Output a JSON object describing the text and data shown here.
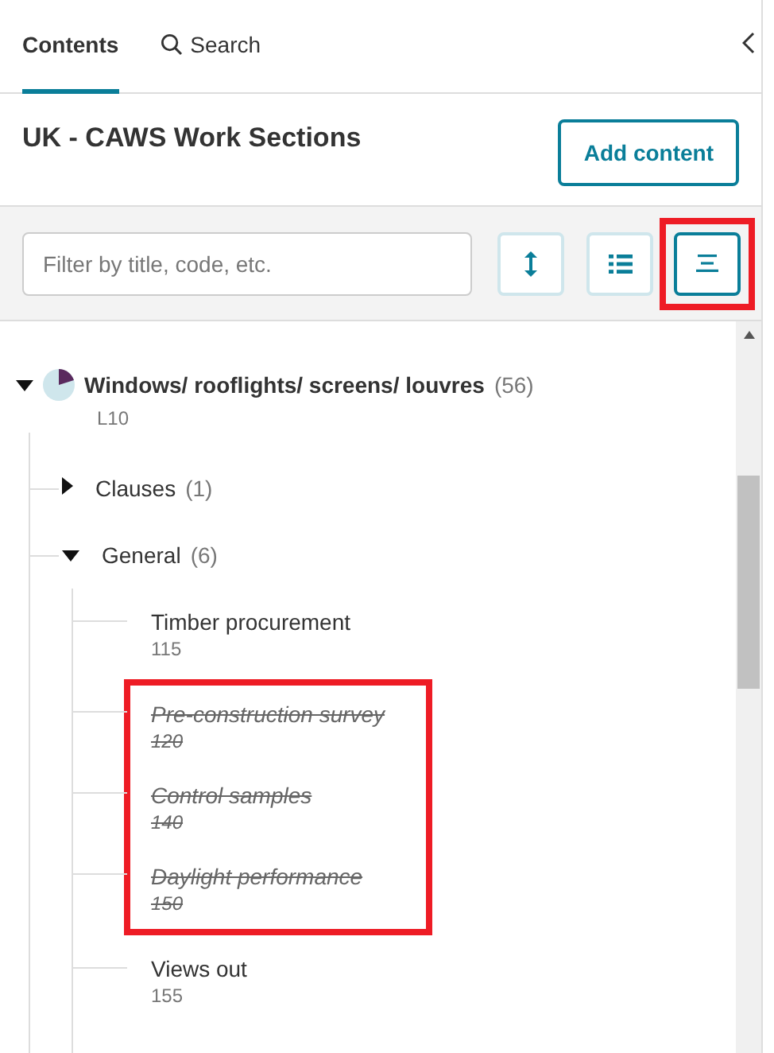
{
  "tabs": [
    {
      "label": "Contents",
      "kind": "plain",
      "selected": true
    },
    {
      "label": "Search",
      "kind": "search",
      "selected": false
    }
  ],
  "heading": "UK - CAWS Work Sections",
  "add_button": "Add content",
  "filter": {
    "placeholder": "Filter by title, code, etc."
  },
  "view_buttons": [
    {
      "kind": "expand-collapse",
      "selected": false,
      "highlighted": false
    },
    {
      "kind": "list",
      "selected": false,
      "highlighted": false
    },
    {
      "kind": "compact",
      "selected": true,
      "highlighted": true
    }
  ],
  "tree": {
    "title": "Windows/ rooflights/ screens/ louvres",
    "count": "(56)",
    "code": "L10",
    "expanded": true,
    "children": [
      {
        "title": "Clauses",
        "count": "(1)",
        "expanded": false
      },
      {
        "title": "General",
        "count": "(6)",
        "expanded": true,
        "children": [
          {
            "title": "Timber procurement",
            "code": "115",
            "deleted": false,
            "highlighted": false
          },
          {
            "title": "Pre-construction survey",
            "code": "120",
            "deleted": true,
            "highlighted": true
          },
          {
            "title": "Control samples",
            "code": "140",
            "deleted": true,
            "highlighted": true
          },
          {
            "title": "Daylight performance",
            "code": "150",
            "deleted": true,
            "highlighted": true
          },
          {
            "title": "Views out",
            "code": "155",
            "deleted": false,
            "highlighted": false
          }
        ]
      }
    ]
  }
}
